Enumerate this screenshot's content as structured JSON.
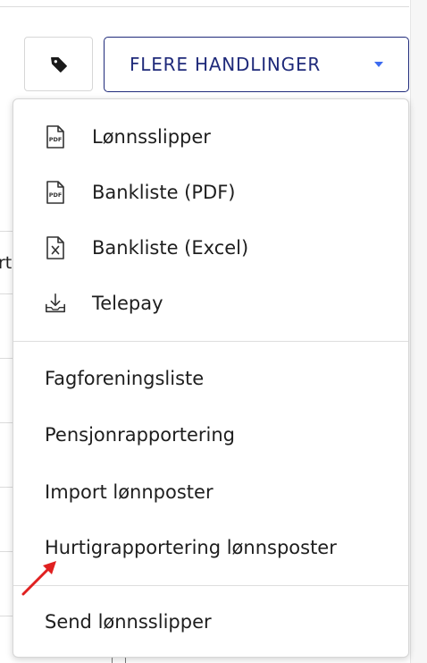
{
  "toolbar": {
    "tag_button_icon": "tag-icon",
    "actions_label": "FLERE HANDLINGER",
    "actions_caret_icon": "caret-down-icon",
    "accent_color": "#1f2a7a",
    "caret_color": "#3c6bf0"
  },
  "background": {
    "partial_text": "rt"
  },
  "menu": {
    "group_export": [
      {
        "label": "Lønnsslipper",
        "icon": "pdf-file-icon"
      },
      {
        "label": "Bankliste (PDF)",
        "icon": "pdf-file-icon"
      },
      {
        "label": "Bankliste (Excel)",
        "icon": "excel-file-icon"
      },
      {
        "label": "Telepay",
        "icon": "download-tray-icon"
      }
    ],
    "group_reports": [
      {
        "label": "Fagforeningsliste"
      },
      {
        "label": "Pensjonrapportering"
      },
      {
        "label": "Import lønnposter"
      },
      {
        "label": "Hurtigrapportering lønnsposter"
      }
    ],
    "group_send": [
      {
        "label": "Send lønnsslipper"
      }
    ]
  },
  "annotation": {
    "arrow_color": "#e02020",
    "arrow_icon": "red-arrow-icon"
  }
}
